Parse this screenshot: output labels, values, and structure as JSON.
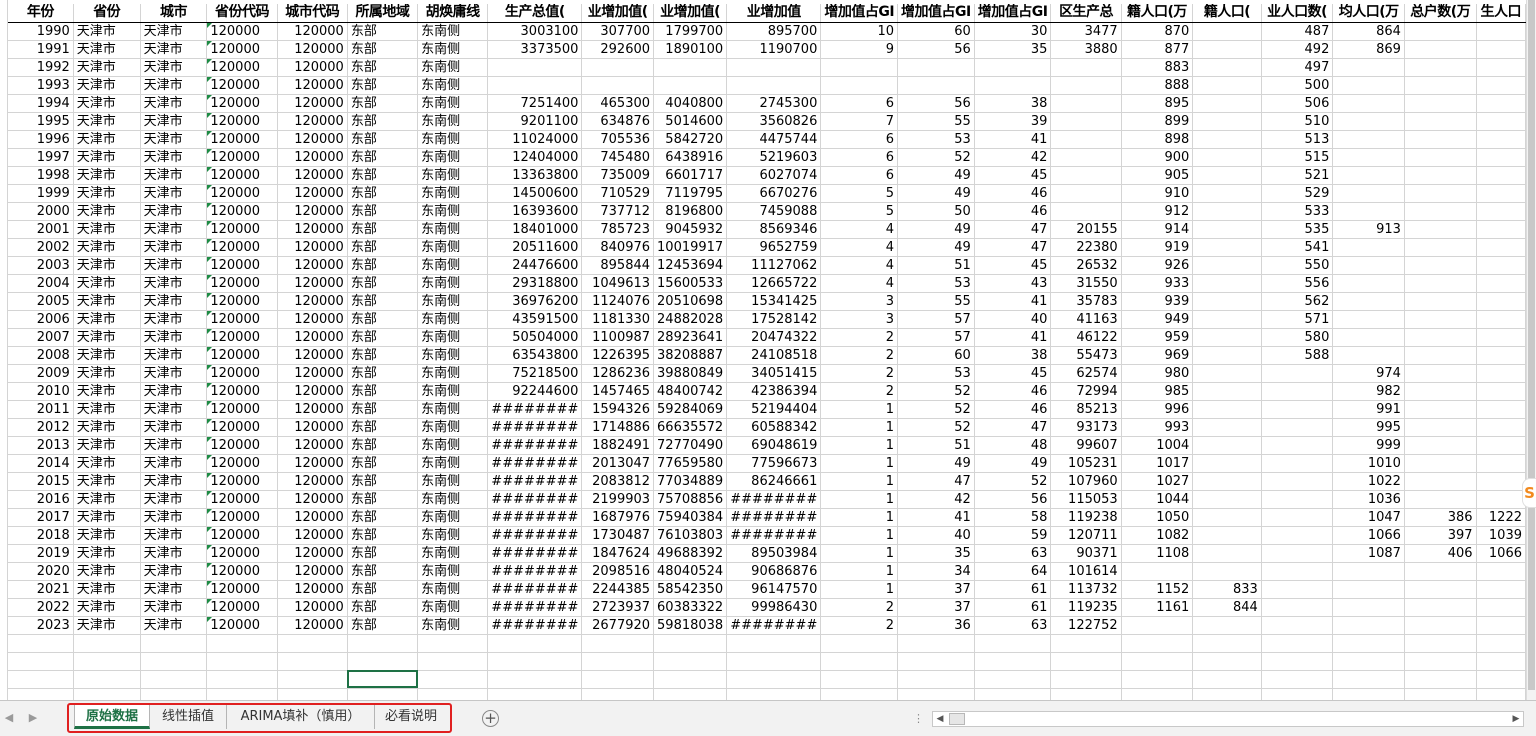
{
  "sheet": {
    "headers": [
      "年份",
      "省份",
      "城市",
      "省份代码",
      "城市代码",
      "所属地域",
      "胡焕庸线",
      "生产总值(",
      "业增加值(",
      "业增加值(",
      "业增加值",
      "增加值占GI",
      "增加值占GI",
      "增加值占GI",
      "区生产总",
      "籍人口(万",
      "籍人口(",
      "业人口数(",
      "均人口(万",
      "总户数(万",
      "生人口"
    ],
    "rows": [
      [
        "1990",
        "天津市",
        "天津市",
        "120000",
        "120000",
        "东部",
        "东南侧",
        "3003100",
        "307700",
        "1799700",
        "895700",
        "10",
        "60",
        "30",
        "3477",
        "870",
        "",
        "487",
        "864",
        "",
        ""
      ],
      [
        "1991",
        "天津市",
        "天津市",
        "120000",
        "120000",
        "东部",
        "东南侧",
        "3373500",
        "292600",
        "1890100",
        "1190700",
        "9",
        "56",
        "35",
        "3880",
        "877",
        "",
        "492",
        "869",
        "",
        ""
      ],
      [
        "1992",
        "天津市",
        "天津市",
        "120000",
        "120000",
        "东部",
        "东南侧",
        "",
        "",
        "",
        "",
        "",
        "",
        "",
        "",
        "883",
        "",
        "497",
        "",
        "",
        ""
      ],
      [
        "1993",
        "天津市",
        "天津市",
        "120000",
        "120000",
        "东部",
        "东南侧",
        "",
        "",
        "",
        "",
        "",
        "",
        "",
        "",
        "888",
        "",
        "500",
        "",
        "",
        ""
      ],
      [
        "1994",
        "天津市",
        "天津市",
        "120000",
        "120000",
        "东部",
        "东南侧",
        "7251400",
        "465300",
        "4040800",
        "2745300",
        "6",
        "56",
        "38",
        "",
        "895",
        "",
        "506",
        "",
        "",
        ""
      ],
      [
        "1995",
        "天津市",
        "天津市",
        "120000",
        "120000",
        "东部",
        "东南侧",
        "9201100",
        "634876",
        "5014600",
        "3560826",
        "7",
        "55",
        "39",
        "",
        "899",
        "",
        "510",
        "",
        "",
        ""
      ],
      [
        "1996",
        "天津市",
        "天津市",
        "120000",
        "120000",
        "东部",
        "东南侧",
        "11024000",
        "705536",
        "5842720",
        "4475744",
        "6",
        "53",
        "41",
        "",
        "898",
        "",
        "513",
        "",
        "",
        ""
      ],
      [
        "1997",
        "天津市",
        "天津市",
        "120000",
        "120000",
        "东部",
        "东南侧",
        "12404000",
        "745480",
        "6438916",
        "5219603",
        "6",
        "52",
        "42",
        "",
        "900",
        "",
        "515",
        "",
        "",
        ""
      ],
      [
        "1998",
        "天津市",
        "天津市",
        "120000",
        "120000",
        "东部",
        "东南侧",
        "13363800",
        "735009",
        "6601717",
        "6027074",
        "6",
        "49",
        "45",
        "",
        "905",
        "",
        "521",
        "",
        "",
        ""
      ],
      [
        "1999",
        "天津市",
        "天津市",
        "120000",
        "120000",
        "东部",
        "东南侧",
        "14500600",
        "710529",
        "7119795",
        "6670276",
        "5",
        "49",
        "46",
        "",
        "910",
        "",
        "529",
        "",
        "",
        ""
      ],
      [
        "2000",
        "天津市",
        "天津市",
        "120000",
        "120000",
        "东部",
        "东南侧",
        "16393600",
        "737712",
        "8196800",
        "7459088",
        "5",
        "50",
        "46",
        "",
        "912",
        "",
        "533",
        "",
        "",
        ""
      ],
      [
        "2001",
        "天津市",
        "天津市",
        "120000",
        "120000",
        "东部",
        "东南侧",
        "18401000",
        "785723",
        "9045932",
        "8569346",
        "4",
        "49",
        "47",
        "20155",
        "914",
        "",
        "535",
        "913",
        "",
        ""
      ],
      [
        "2002",
        "天津市",
        "天津市",
        "120000",
        "120000",
        "东部",
        "东南侧",
        "20511600",
        "840976",
        "10019917",
        "9652759",
        "4",
        "49",
        "47",
        "22380",
        "919",
        "",
        "541",
        "",
        "",
        ""
      ],
      [
        "2003",
        "天津市",
        "天津市",
        "120000",
        "120000",
        "东部",
        "东南侧",
        "24476600",
        "895844",
        "12453694",
        "11127062",
        "4",
        "51",
        "45",
        "26532",
        "926",
        "",
        "550",
        "",
        "",
        ""
      ],
      [
        "2004",
        "天津市",
        "天津市",
        "120000",
        "120000",
        "东部",
        "东南侧",
        "29318800",
        "1049613",
        "15600533",
        "12665722",
        "4",
        "53",
        "43",
        "31550",
        "933",
        "",
        "556",
        "",
        "",
        ""
      ],
      [
        "2005",
        "天津市",
        "天津市",
        "120000",
        "120000",
        "东部",
        "东南侧",
        "36976200",
        "1124076",
        "20510698",
        "15341425",
        "3",
        "55",
        "41",
        "35783",
        "939",
        "",
        "562",
        "",
        "",
        ""
      ],
      [
        "2006",
        "天津市",
        "天津市",
        "120000",
        "120000",
        "东部",
        "东南侧",
        "43591500",
        "1181330",
        "24882028",
        "17528142",
        "3",
        "57",
        "40",
        "41163",
        "949",
        "",
        "571",
        "",
        "",
        ""
      ],
      [
        "2007",
        "天津市",
        "天津市",
        "120000",
        "120000",
        "东部",
        "东南侧",
        "50504000",
        "1100987",
        "28923641",
        "20474322",
        "2",
        "57",
        "41",
        "46122",
        "959",
        "",
        "580",
        "",
        "",
        ""
      ],
      [
        "2008",
        "天津市",
        "天津市",
        "120000",
        "120000",
        "东部",
        "东南侧",
        "63543800",
        "1226395",
        "38208887",
        "24108518",
        "2",
        "60",
        "38",
        "55473",
        "969",
        "",
        "588",
        "",
        "",
        ""
      ],
      [
        "2009",
        "天津市",
        "天津市",
        "120000",
        "120000",
        "东部",
        "东南侧",
        "75218500",
        "1286236",
        "39880849",
        "34051415",
        "2",
        "53",
        "45",
        "62574",
        "980",
        "",
        "",
        "974",
        "",
        ""
      ],
      [
        "2010",
        "天津市",
        "天津市",
        "120000",
        "120000",
        "东部",
        "东南侧",
        "92244600",
        "1457465",
        "48400742",
        "42386394",
        "2",
        "52",
        "46",
        "72994",
        "985",
        "",
        "",
        "982",
        "",
        ""
      ],
      [
        "2011",
        "天津市",
        "天津市",
        "120000",
        "120000",
        "东部",
        "东南侧",
        "########",
        "1594326",
        "59284069",
        "52194404",
        "1",
        "52",
        "46",
        "85213",
        "996",
        "",
        "",
        "991",
        "",
        ""
      ],
      [
        "2012",
        "天津市",
        "天津市",
        "120000",
        "120000",
        "东部",
        "东南侧",
        "########",
        "1714886",
        "66635572",
        "60588342",
        "1",
        "52",
        "47",
        "93173",
        "993",
        "",
        "",
        "995",
        "",
        ""
      ],
      [
        "2013",
        "天津市",
        "天津市",
        "120000",
        "120000",
        "东部",
        "东南侧",
        "########",
        "1882491",
        "72770490",
        "69048619",
        "1",
        "51",
        "48",
        "99607",
        "1004",
        "",
        "",
        "999",
        "",
        ""
      ],
      [
        "2014",
        "天津市",
        "天津市",
        "120000",
        "120000",
        "东部",
        "东南侧",
        "########",
        "2013047",
        "77659580",
        "77596673",
        "1",
        "49",
        "49",
        "105231",
        "1017",
        "",
        "",
        "1010",
        "",
        ""
      ],
      [
        "2015",
        "天津市",
        "天津市",
        "120000",
        "120000",
        "东部",
        "东南侧",
        "########",
        "2083812",
        "77034889",
        "86246661",
        "1",
        "47",
        "52",
        "107960",
        "1027",
        "",
        "",
        "1022",
        "",
        ""
      ],
      [
        "2016",
        "天津市",
        "天津市",
        "120000",
        "120000",
        "东部",
        "东南侧",
        "########",
        "2199903",
        "75708856",
        "########",
        "1",
        "42",
        "56",
        "115053",
        "1044",
        "",
        "",
        "1036",
        "",
        ""
      ],
      [
        "2017",
        "天津市",
        "天津市",
        "120000",
        "120000",
        "东部",
        "东南侧",
        "########",
        "1687976",
        "75940384",
        "########",
        "1",
        "41",
        "58",
        "119238",
        "1050",
        "",
        "",
        "1047",
        "386",
        "1222"
      ],
      [
        "2018",
        "天津市",
        "天津市",
        "120000",
        "120000",
        "东部",
        "东南侧",
        "########",
        "1730487",
        "76103803",
        "########",
        "1",
        "40",
        "59",
        "120711",
        "1082",
        "",
        "",
        "1066",
        "397",
        "1039"
      ],
      [
        "2019",
        "天津市",
        "天津市",
        "120000",
        "120000",
        "东部",
        "东南侧",
        "########",
        "1847624",
        "49688392",
        "89503984",
        "1",
        "35",
        "63",
        "90371",
        "1108",
        "",
        "",
        "1087",
        "406",
        "1066"
      ],
      [
        "2020",
        "天津市",
        "天津市",
        "120000",
        "120000",
        "东部",
        "东南侧",
        "########",
        "2098516",
        "48040524",
        "90686876",
        "1",
        "34",
        "64",
        "101614",
        "",
        "",
        "",
        "",
        "",
        ""
      ],
      [
        "2021",
        "天津市",
        "天津市",
        "120000",
        "120000",
        "东部",
        "东南侧",
        "########",
        "2244385",
        "58542350",
        "96147570",
        "1",
        "37",
        "61",
        "113732",
        "1152",
        "833",
        "",
        "",
        "",
        ""
      ],
      [
        "2022",
        "天津市",
        "天津市",
        "120000",
        "120000",
        "东部",
        "东南侧",
        "########",
        "2723937",
        "60383322",
        "99986430",
        "2",
        "37",
        "61",
        "119235",
        "1161",
        "844",
        "",
        "",
        "",
        ""
      ],
      [
        "2023",
        "天津市",
        "天津市",
        "120000",
        "120000",
        "东部",
        "东南侧",
        "########",
        "2677920",
        "59818038",
        "########",
        "2",
        "36",
        "63",
        "122752",
        "",
        "",
        "",
        "",
        "",
        ""
      ]
    ]
  },
  "tabs": [
    {
      "label": "原始数据",
      "active": true
    },
    {
      "label": "线性插值",
      "active": false
    },
    {
      "label": "ARIMA填补（慎用）",
      "active": false
    },
    {
      "label": "必看说明",
      "active": false
    }
  ],
  "icons": {
    "prev": "◀",
    "next": "▶",
    "add": "+",
    "badge": "S",
    "dots": "⋮"
  },
  "colors": {
    "accent": "#1e7145",
    "highlight": "#e02020",
    "gridline": "#d4d4d4"
  }
}
